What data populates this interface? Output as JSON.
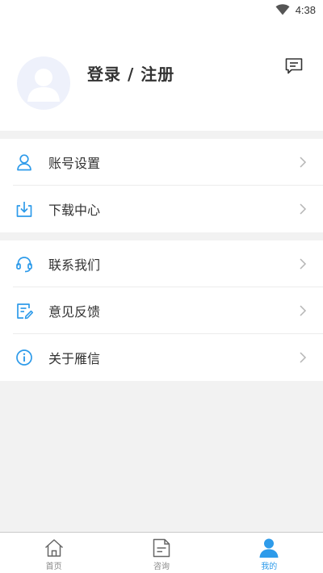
{
  "status_bar": {
    "time": "4:38",
    "wifi_icon": "wifi-icon"
  },
  "profile": {
    "avatar_icon": "default-avatar-icon",
    "login_label": "登录 / 注册",
    "message_icon": "message-icon"
  },
  "menu": {
    "group1": [
      {
        "label": "账号设置",
        "icon": "user-icon"
      },
      {
        "label": "下载中心",
        "icon": "download-icon"
      }
    ],
    "group2": [
      {
        "label": "联系我们",
        "icon": "headset-icon"
      },
      {
        "label": "意见反馈",
        "icon": "feedback-edit-icon"
      },
      {
        "label": "关于雁信",
        "icon": "info-icon"
      }
    ]
  },
  "tabbar": {
    "tabs": [
      {
        "label": "首页",
        "icon": "home-icon",
        "active": false
      },
      {
        "label": "咨询",
        "icon": "document-icon",
        "active": false
      },
      {
        "label": "我的",
        "icon": "profile-icon",
        "active": true
      }
    ]
  },
  "colors": {
    "accent": "#2e9bea",
    "text": "#333333",
    "background": "#f2f2f2"
  }
}
